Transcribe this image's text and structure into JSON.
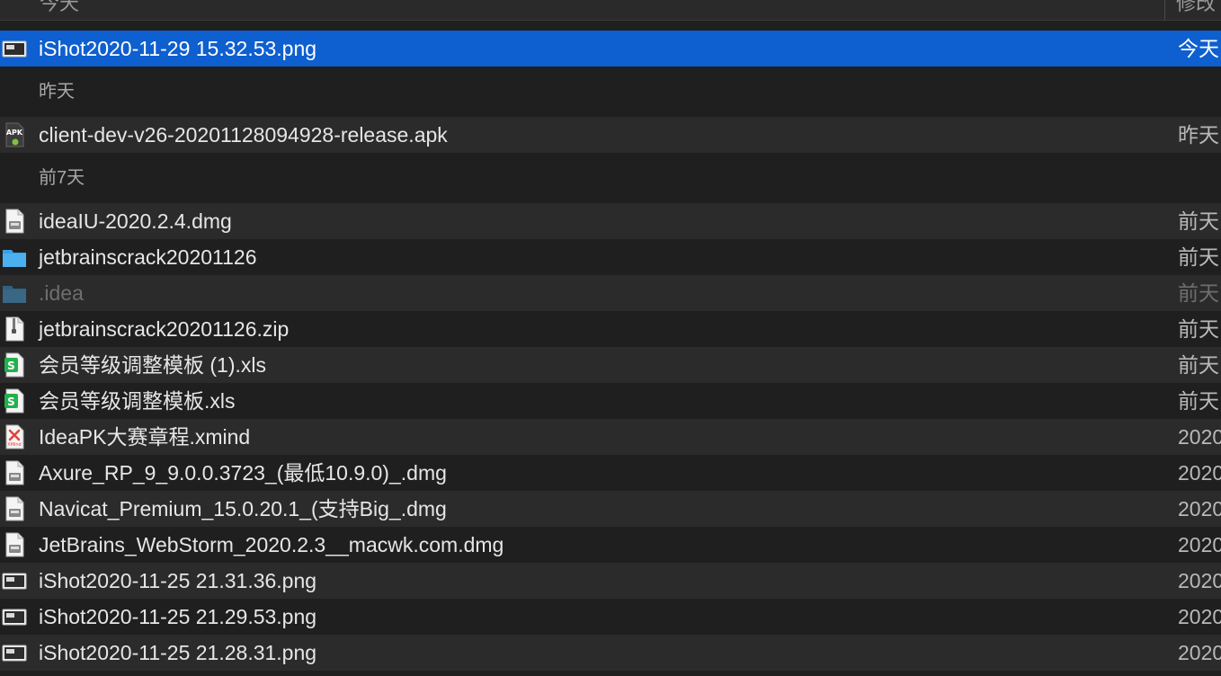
{
  "header": {
    "col_name": "今天",
    "col_date": "修改"
  },
  "rows": [
    {
      "kind": "file",
      "icon": "image-file-icon",
      "name": "iShot2020-11-29 15.32.53.png",
      "date": "今天",
      "state": "selected"
    },
    {
      "kind": "group",
      "name": "昨天"
    },
    {
      "kind": "file",
      "icon": "apk-file-icon",
      "name": "client-dev-v26-20201128094928-release.apk",
      "date": "昨天"
    },
    {
      "kind": "group",
      "name": "前7天"
    },
    {
      "kind": "file",
      "icon": "disk-image-icon",
      "name": "ideaIU-2020.2.4.dmg",
      "date": "前天"
    },
    {
      "kind": "file",
      "icon": "folder-icon",
      "name": "jetbrainscrack20201126",
      "date": "前天"
    },
    {
      "kind": "file",
      "icon": "folder-icon",
      "name": ".idea",
      "date": "前天",
      "state": "dim"
    },
    {
      "kind": "file",
      "icon": "zip-file-icon",
      "name": "jetbrainscrack20201126.zip",
      "date": "前天"
    },
    {
      "kind": "file",
      "icon": "spreadsheet-icon",
      "name": "会员等级调整模板 (1).xls",
      "date": "前天"
    },
    {
      "kind": "file",
      "icon": "spreadsheet-icon",
      "name": "会员等级调整模板.xls",
      "date": "前天"
    },
    {
      "kind": "file",
      "icon": "xmind-file-icon",
      "name": "IdeaPK大赛章程.xmind",
      "date": "2020"
    },
    {
      "kind": "file",
      "icon": "disk-image-icon",
      "name": "Axure_RP_9_9.0.0.3723_(最低10.9.0)_.dmg",
      "date": "2020"
    },
    {
      "kind": "file",
      "icon": "disk-image-icon",
      "name": "Navicat_Premium_15.0.20.1_(支持Big_.dmg",
      "date": "2020"
    },
    {
      "kind": "file",
      "icon": "disk-image-icon",
      "name": "JetBrains_WebStorm_2020.2.3__macwk.com.dmg",
      "date": "2020"
    },
    {
      "kind": "file",
      "icon": "image-file-icon",
      "name": "iShot2020-11-25 21.31.36.png",
      "date": "2020"
    },
    {
      "kind": "file",
      "icon": "image-file-icon",
      "name": "iShot2020-11-25 21.29.53.png",
      "date": "2020"
    },
    {
      "kind": "file",
      "icon": "image-file-icon",
      "name": "iShot2020-11-25 21.28.31.png",
      "date": "2020"
    }
  ],
  "colors": {
    "selection": "#0e5fcf",
    "folder": "#3aa0e6",
    "spreadsheet": "#22b14c",
    "xmind": "#e0443a"
  }
}
